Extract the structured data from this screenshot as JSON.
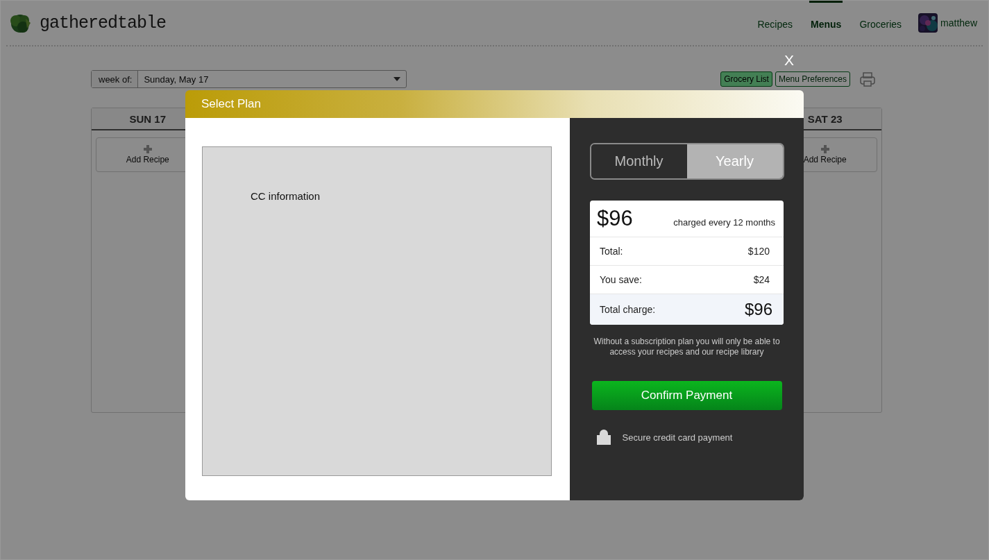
{
  "header": {
    "logo": "gatheredtable",
    "nav": [
      {
        "label": "Recipes",
        "selected": false
      },
      {
        "label": "Menus",
        "selected": true
      },
      {
        "label": "Groceries",
        "selected": false
      }
    ],
    "user": {
      "name": "matthew"
    }
  },
  "planner": {
    "week_label": "week of:",
    "week_value": "Sunday, May 17",
    "buttons": [
      {
        "label": "Grocery List",
        "kind": "filled"
      },
      {
        "label": "Menu Preferences",
        "kind": "outline"
      }
    ],
    "days": [
      {
        "label": "SUN 17",
        "add_label": "Add Recipe"
      },
      {
        "label": "SAT 23",
        "add_label": "Add Recipe"
      }
    ]
  },
  "modal": {
    "title": "Select Plan",
    "close": "X",
    "payment_area": {
      "label": "CC information"
    },
    "billing_options": [
      {
        "label": "Monthly",
        "selected": false
      },
      {
        "label": "Yearly",
        "selected": true
      }
    ],
    "price": {
      "amount": "$96",
      "period": "charged every 12 months"
    },
    "summary_rows": [
      {
        "label": "Total:",
        "value": "$120",
        "kind": "normal"
      },
      {
        "label": "You save:",
        "value": "$24",
        "kind": "normal"
      },
      {
        "label": "Total charge:",
        "value": "$96",
        "kind": "total"
      }
    ],
    "note": "Without a subscription plan you will only be able to access your recipes and our recipe library",
    "confirm_button": "Confirm Payment",
    "secure_note": "Secure credit card payment"
  }
}
